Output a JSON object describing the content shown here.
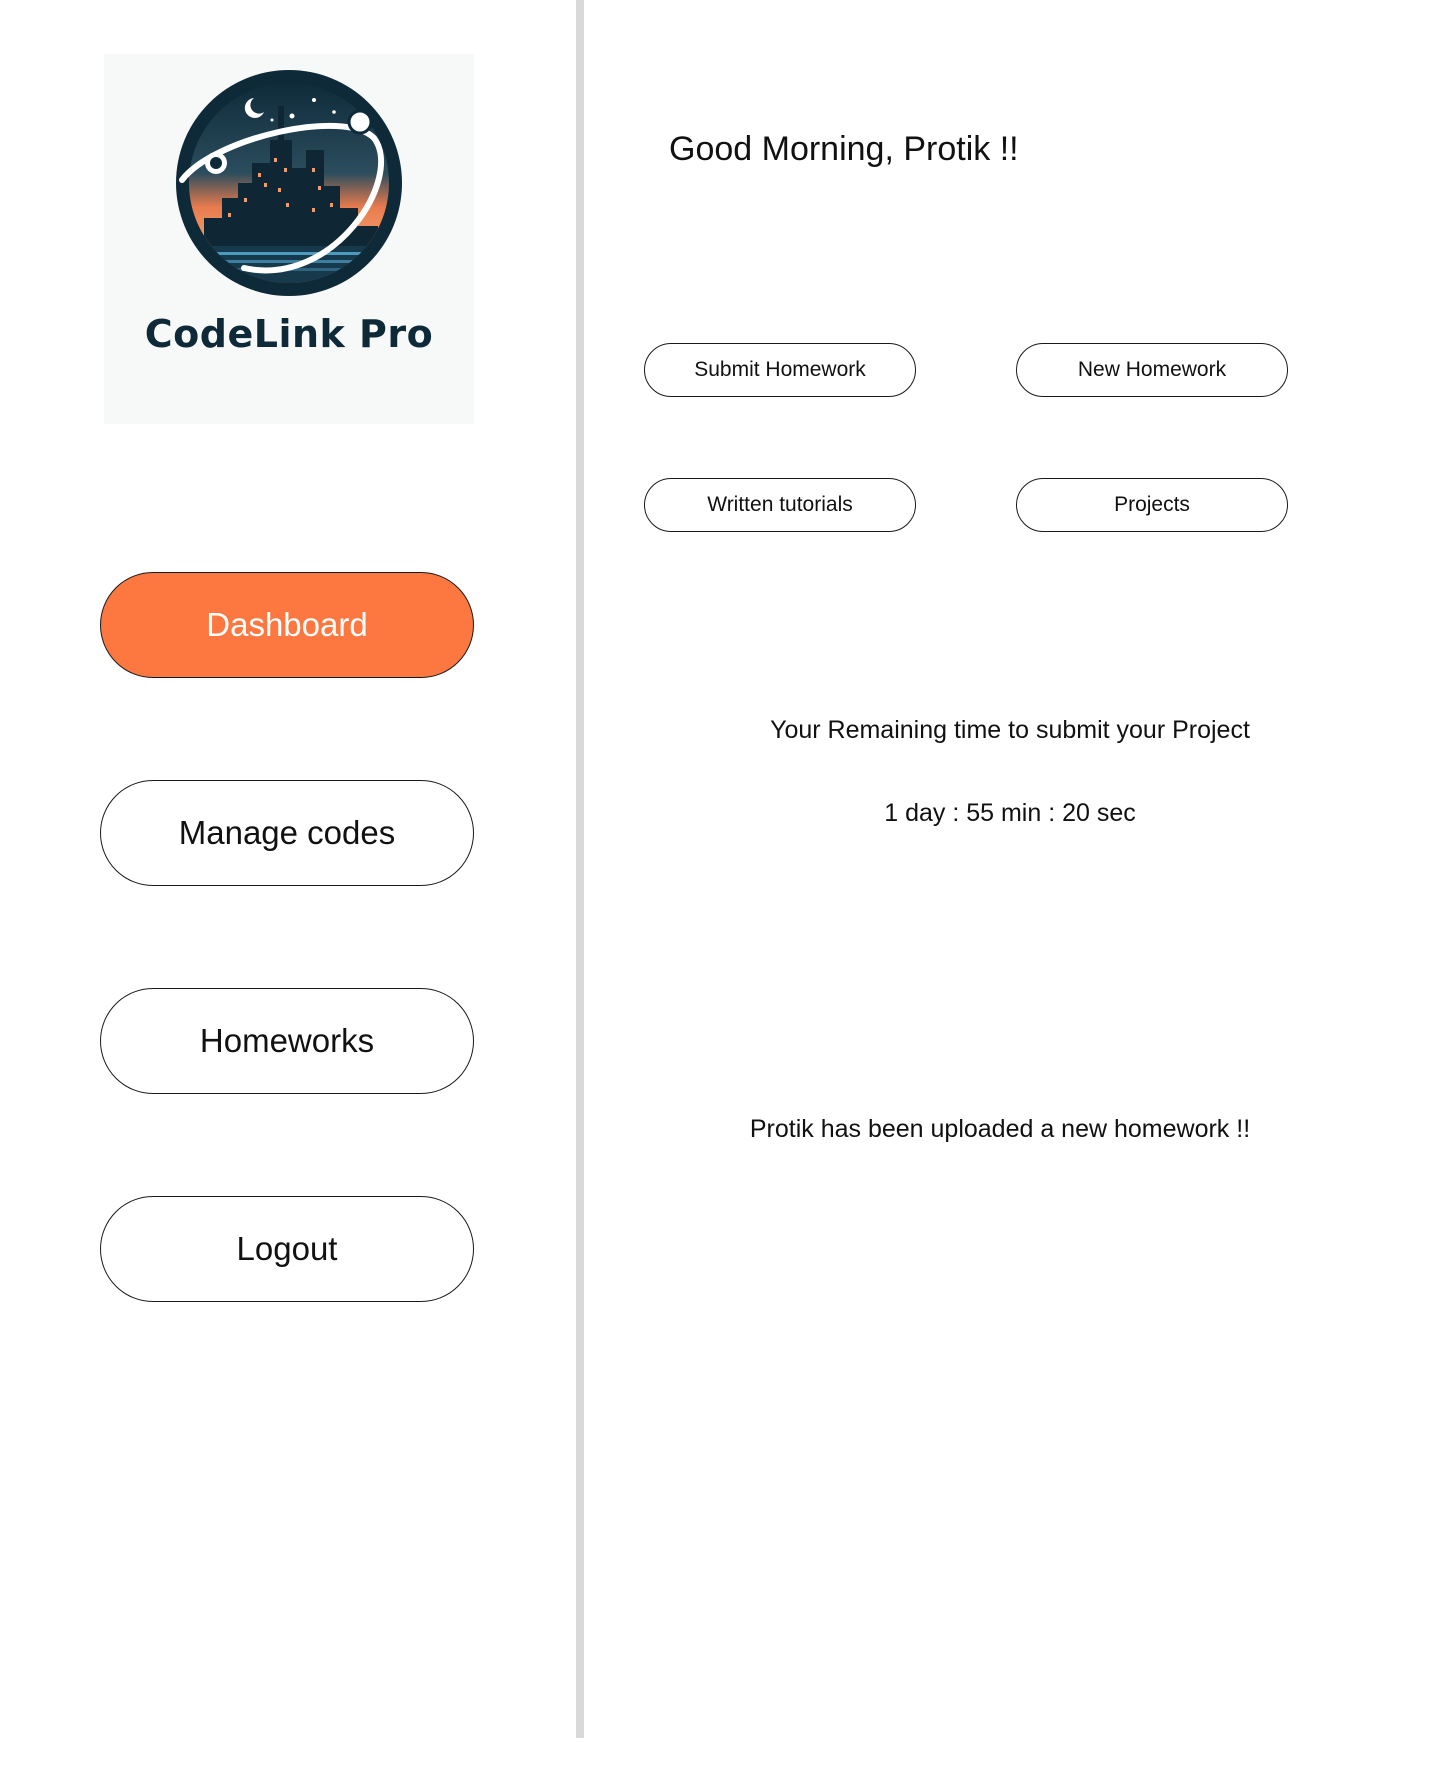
{
  "brand": {
    "name": "CodeLink Pro"
  },
  "colors": {
    "accent": "#fd7840",
    "brand_dark": "#0e2a38",
    "divider": "#d9d9d9",
    "logo_bg": "#f7f8f8"
  },
  "sidebar": {
    "items": [
      {
        "label": "Dashboard",
        "active": true
      },
      {
        "label": "Manage codes",
        "active": false
      },
      {
        "label": "Homeworks",
        "active": false
      },
      {
        "label": "Logout",
        "active": false
      }
    ]
  },
  "main": {
    "greeting": "Good Morning, Protik !!",
    "actions": [
      {
        "label": "Submit Homework"
      },
      {
        "label": "New Homework"
      },
      {
        "label": "Written tutorials"
      },
      {
        "label": "Projects"
      }
    ],
    "countdown": {
      "label": "Your Remaining time to submit your Project",
      "value": "1 day : 55 min : 20 sec"
    },
    "notification": "Protik has been uploaded a new homework !!"
  }
}
